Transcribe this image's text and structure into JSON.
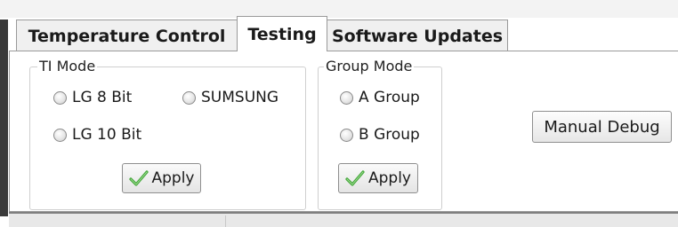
{
  "tabs": [
    {
      "label": "Temperature Control"
    },
    {
      "label": "Testing",
      "selected": true
    },
    {
      "label": "Software Updates"
    }
  ],
  "ti_mode": {
    "legend": "TI Mode",
    "options": [
      {
        "label": "LG 8 Bit",
        "checked": false
      },
      {
        "label": "SUMSUNG",
        "checked": false
      },
      {
        "label": "LG 10 Bit",
        "checked": false
      }
    ],
    "apply_label": "Apply"
  },
  "group_mode": {
    "legend": "Group Mode",
    "options": [
      {
        "label": "A Group",
        "checked": false
      },
      {
        "label": "B Group",
        "checked": false
      }
    ],
    "apply_label": "Apply"
  },
  "manual_debug_label": "Manual Debug",
  "icons": {
    "apply": "green-checkmark-icon",
    "radio": "radio-unchecked-icon"
  },
  "colors": {
    "checkmark": "#3fa535",
    "tab_border": "#9a9a9a"
  }
}
